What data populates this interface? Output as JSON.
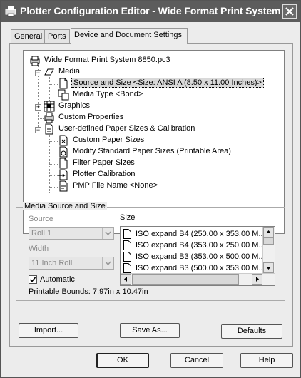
{
  "window": {
    "title": "Plotter Configuration Editor - Wide Format Print System ..."
  },
  "tabs": [
    {
      "label": "General"
    },
    {
      "label": "Ports"
    },
    {
      "label": "Device and Document Settings"
    }
  ],
  "tree": {
    "items": [
      {
        "label": "Wide Format Print System 8850.pc3"
      },
      {
        "label": "Media"
      },
      {
        "label": "Source and Size <Size: ANSI A (8.50 x 11.00 Inches)>"
      },
      {
        "label": "Media Type <Bond>"
      },
      {
        "label": "Graphics"
      },
      {
        "label": "Custom Properties"
      },
      {
        "label": "User-defined Paper Sizes & Calibration"
      },
      {
        "label": "Custom Paper Sizes"
      },
      {
        "label": "Modify Standard Paper Sizes (Printable Area)"
      },
      {
        "label": "Filter Paper Sizes"
      },
      {
        "label": "Plotter Calibration"
      },
      {
        "label": "PMP File Name <None>"
      }
    ]
  },
  "media": {
    "group_title": "Media Source and Size",
    "source_label": "Source",
    "source_value": "Roll 1",
    "width_label": "Width",
    "width_value": "11 Inch Roll",
    "size_label": "Size",
    "automatic_label": "Automatic",
    "printable_bounds": "Printable Bounds: 7.97in x 10.47in",
    "sizes": [
      "ISO expand B4 (250.00 x 353.00 M...",
      "ISO expand B4 (353.00 x 250.00 M...",
      "ISO expand B3 (353.00 x 500.00 M...",
      "ISO expand B3 (500.00 x 353.00 M..."
    ]
  },
  "buttons": {
    "import": "Import...",
    "save_as": "Save As...",
    "defaults": "Defaults",
    "ok": "OK",
    "cancel": "Cancel",
    "help": "Help"
  }
}
